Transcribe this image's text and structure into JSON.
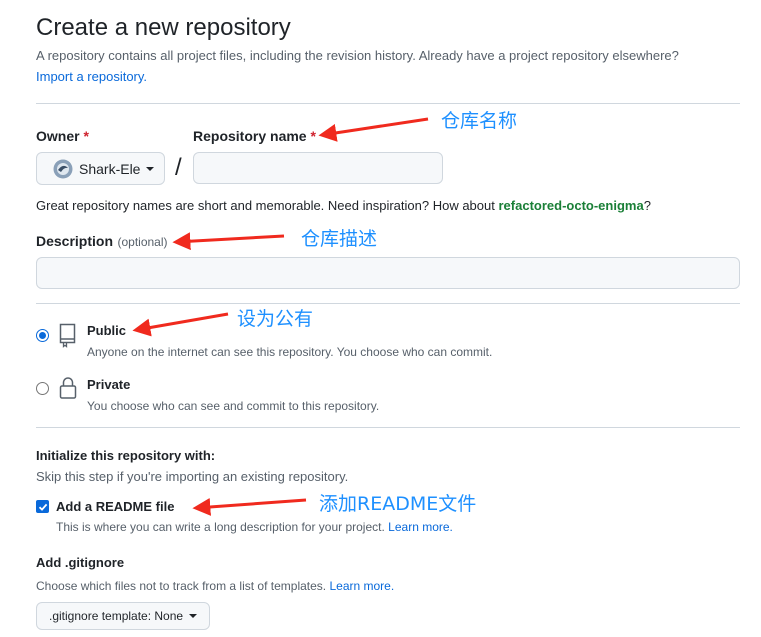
{
  "header": {
    "title": "Create a new repository",
    "subtitle": "A repository contains all project files, including the revision history. Already have a project repository elsewhere?",
    "import_link": "Import a repository."
  },
  "owner": {
    "label": "Owner",
    "required_mark": "*",
    "selected": "Shark-Ele"
  },
  "separator": "/",
  "repo_name": {
    "label": "Repository name",
    "required_mark": "*",
    "value": ""
  },
  "name_hint": {
    "text": "Great repository names are short and memorable. Need inspiration? How about",
    "suggestion": "refactored-octo-enigma",
    "end": "?"
  },
  "description": {
    "label": "Description",
    "optional": "(optional)",
    "value": ""
  },
  "visibility": {
    "public": {
      "label": "Public",
      "desc": "Anyone on the internet can see this repository. You choose who can commit.",
      "checked": true
    },
    "private": {
      "label": "Private",
      "desc": "You choose who can see and commit to this repository.",
      "checked": false
    }
  },
  "init": {
    "title": "Initialize this repository with:",
    "skip": "Skip this step if you're importing an existing repository.",
    "readme_label": "Add a README file",
    "readme_checked": true,
    "readme_desc": "This is where you can write a long description for your project.",
    "learn_more": "Learn more."
  },
  "gitignore": {
    "title": "Add .gitignore",
    "desc": "Choose which files not to track from a list of templates.",
    "learn_more": "Learn more.",
    "button_label": ".gitignore template: None"
  },
  "annotations": {
    "repo_name": "仓库名称",
    "description": "仓库描述",
    "public": "设为公有",
    "readme": "添加README文件"
  },
  "colors": {
    "link": "#0969da",
    "required": "#cf222e",
    "suggestion": "#1a7f37",
    "annotation": "#1e90ff",
    "arrow": "#f02a1e"
  }
}
